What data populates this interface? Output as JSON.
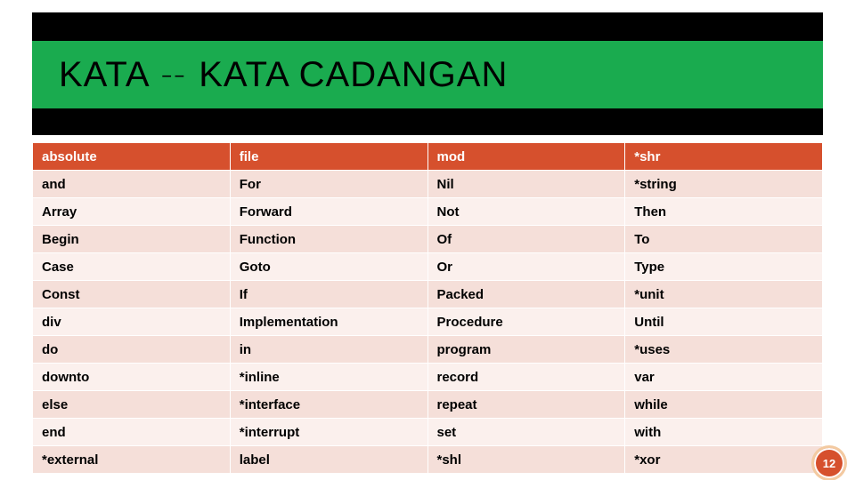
{
  "slide": {
    "title_left": "KATA",
    "title_right": "KATA CADANGAN",
    "page_number": "12"
  },
  "table": {
    "header": [
      "absolute",
      "file",
      "mod",
      "*shr"
    ],
    "rows": [
      [
        "and",
        "For",
        "Nil",
        "*string"
      ],
      [
        "Array",
        "Forward",
        "Not",
        "Then"
      ],
      [
        "Begin",
        "Function",
        "Of",
        "To"
      ],
      [
        "Case",
        "Goto",
        "Or",
        "Type"
      ],
      [
        "Const",
        "If",
        "Packed",
        "*unit"
      ],
      [
        "div",
        "Implementation",
        "Procedure",
        "Until"
      ],
      [
        "do",
        "in",
        "program",
        "*uses"
      ],
      [
        "downto",
        "*inline",
        "record",
        "var"
      ],
      [
        "else",
        "*interface",
        "repeat",
        "while"
      ],
      [
        "end",
        "*interrupt",
        "set",
        "with"
      ],
      [
        "*external",
        "label",
        "*shl",
        "*xor"
      ]
    ]
  }
}
